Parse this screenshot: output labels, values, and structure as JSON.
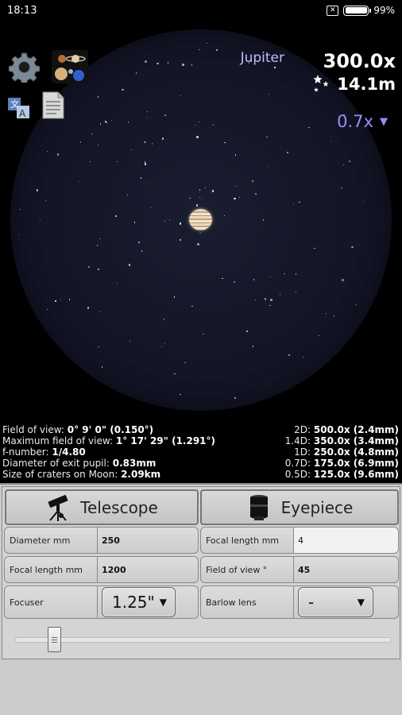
{
  "status": {
    "time": "18:13",
    "battery": "99%",
    "battery_fraction": 0.99,
    "notification_icon": "close-box-icon"
  },
  "viewer": {
    "object_name": "Jupiter",
    "magnification": "300.0x",
    "limiting_magnitude": "14.1m",
    "zoom": "0.7x",
    "colors": {
      "circle": "#141627",
      "object_name": "#c5b8ff",
      "zoom": "#9c8cff"
    }
  },
  "toolbar_icons": [
    "gear-icon",
    "planets-icon",
    "translate-icon",
    "document-icon"
  ],
  "info": {
    "left": [
      {
        "label": "Field of view: ",
        "value": "0° 9' 0\" (0.150°)"
      },
      {
        "label": "Maximum field of view: ",
        "value": "1° 17' 29\" (1.291°)"
      },
      {
        "label": "f-number: ",
        "value": "1/4.80"
      },
      {
        "label": "Diameter of exit pupil: ",
        "value": "0.83mm"
      },
      {
        "label": "Size of craters on Moon: ",
        "value": "2.09km"
      }
    ],
    "right": [
      {
        "label": "2D: ",
        "value": "500.0x (2.4mm)"
      },
      {
        "label": "1.4D: ",
        "value": "350.0x (3.4mm)"
      },
      {
        "label": "1D: ",
        "value": "250.0x (4.8mm)"
      },
      {
        "label": "0.7D: ",
        "value": "175.0x (6.9mm)"
      },
      {
        "label": "0.5D: ",
        "value": "125.0x (9.6mm)"
      }
    ]
  },
  "telescope": {
    "title": "Telescope",
    "diameter_label": "Diameter mm",
    "diameter_value": "250",
    "focal_label": "Focal length mm",
    "focal_value": "1200",
    "focuser_label": "Focuser",
    "focuser_value": "1.25\""
  },
  "eyepiece": {
    "title": "Eyepiece",
    "focal_label": "Focal length mm",
    "focal_value": "4",
    "fov_label": "Field of view °",
    "fov_value": "45",
    "barlow_label": "Barlow lens",
    "barlow_value": "-"
  },
  "slider": {
    "position_fraction": 0.09
  }
}
